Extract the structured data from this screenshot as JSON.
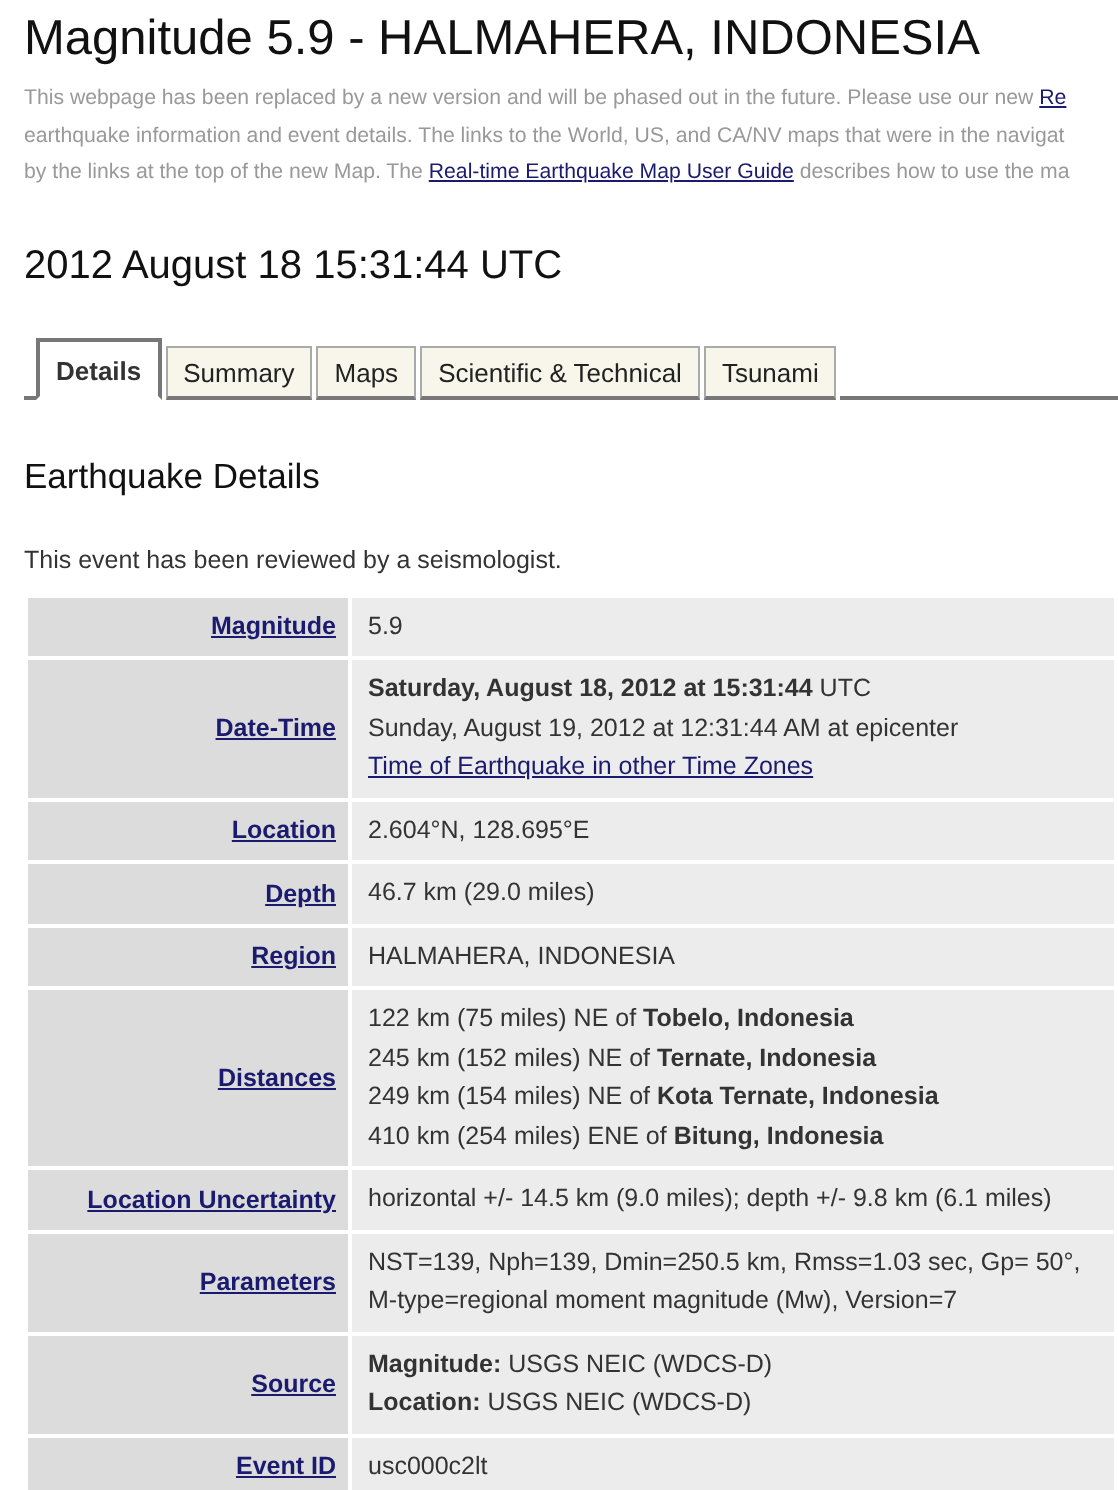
{
  "title": "Magnitude 5.9 - HALMAHERA, INDONESIA",
  "notice": [
    [
      {
        "kind": "text",
        "text": "This webpage has been replaced by a new version and will be phased out in the future. Please use our new "
      },
      {
        "kind": "link",
        "text": "Re"
      }
    ],
    [
      {
        "kind": "text",
        "text": "earthquake information and event details. The links to the World, US, and CA/NV maps that were in the navigat"
      }
    ],
    [
      {
        "kind": "text",
        "text": "by the links at the top of the new Map. The "
      },
      {
        "kind": "link",
        "text": "Real-time Earthquake Map User Guide"
      },
      {
        "kind": "text",
        "text": " describes how to use the ma"
      }
    ]
  ],
  "datetime_heading": "2012 August 18 15:31:44 UTC",
  "tabs": [
    {
      "label": "Details",
      "selected": true
    },
    {
      "label": "Summary",
      "selected": false
    },
    {
      "label": "Maps",
      "selected": false
    },
    {
      "label": "Scientific & Technical",
      "selected": false
    },
    {
      "label": "Tsunami",
      "selected": false
    }
  ],
  "section_title": "Earthquake Details",
  "review_note": "This event has been reviewed by a seismologist.",
  "details": [
    {
      "label": "Magnitude",
      "lines": [
        {
          "kind": "text",
          "text": "5.9"
        }
      ]
    },
    {
      "label": "Date-Time",
      "lines": [
        {
          "kind": "text",
          "text": "**Saturday, August 18, 2012 at 15:31:44** UTC"
        },
        {
          "kind": "text",
          "text": "Sunday, August 19, 2012 at 12:31:44 AM at epicenter"
        },
        {
          "kind": "link",
          "text": "Time of Earthquake in other Time Zones"
        }
      ]
    },
    {
      "label": "Location",
      "lines": [
        {
          "kind": "text",
          "text": "2.604°N, 128.695°E"
        }
      ]
    },
    {
      "label": "Depth",
      "lines": [
        {
          "kind": "text",
          "text": "46.7 km (29.0 miles)"
        }
      ]
    },
    {
      "label": "Region",
      "lines": [
        {
          "kind": "text",
          "text": "HALMAHERA, INDONESIA"
        }
      ]
    },
    {
      "label": "Distances",
      "lines": [
        {
          "kind": "text",
          "text": "122 km (75 miles) NE of **Tobelo, Indonesia**"
        },
        {
          "kind": "text",
          "text": "245 km (152 miles) NE of **Ternate, Indonesia**"
        },
        {
          "kind": "text",
          "text": "249 km (154 miles) NE of **Kota Ternate, Indonesia**"
        },
        {
          "kind": "text",
          "text": "410 km (254 miles) ENE of **Bitung, Indonesia**"
        }
      ]
    },
    {
      "label": "Location Uncertainty",
      "lines": [
        {
          "kind": "text",
          "text": "horizontal +/- 14.5 km (9.0 miles); depth +/- 9.8 km (6.1 miles)"
        }
      ]
    },
    {
      "label": "Parameters",
      "lines": [
        {
          "kind": "text",
          "text": "NST=139, Nph=139, Dmin=250.5 km, Rmss=1.03 sec, Gp= 50°,"
        },
        {
          "kind": "text",
          "text": "M-type=regional moment magnitude (Mw), Version=7"
        }
      ]
    },
    {
      "label": "Source",
      "lines": [
        {
          "kind": "text",
          "text": "**Magnitude:** USGS NEIC (WDCS-D)"
        },
        {
          "kind": "text",
          "text": "**Location:** USGS NEIC (WDCS-D)"
        }
      ]
    },
    {
      "label": "Event ID",
      "lines": [
        {
          "kind": "text",
          "text": "usc000c2lt"
        }
      ]
    }
  ]
}
